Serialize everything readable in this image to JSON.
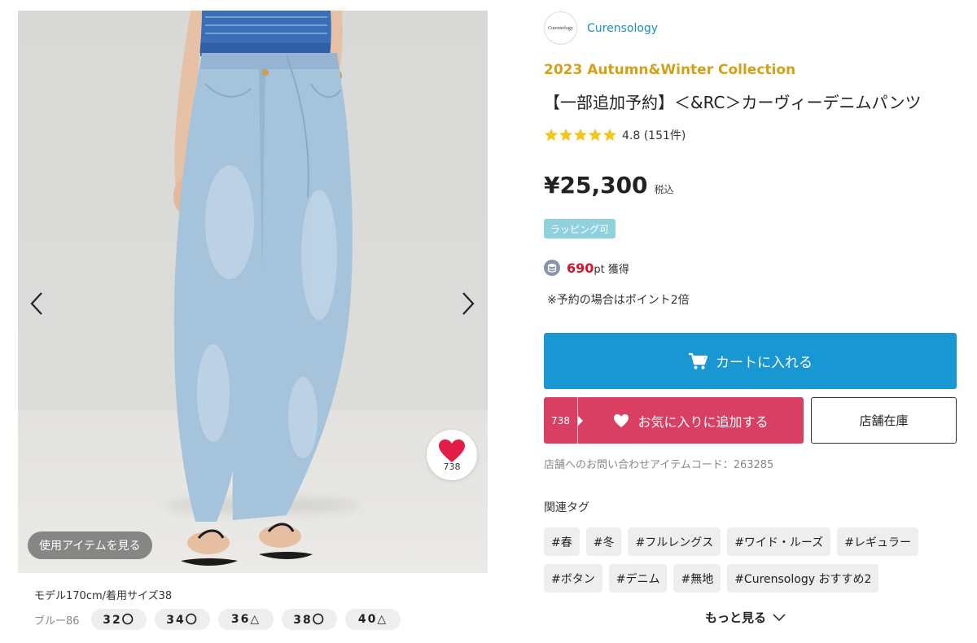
{
  "gallery": {
    "favorite_count": "738",
    "use_items_label": "使用アイテムを見る",
    "model_info": "モデル170cm/着用サイズ38",
    "color_label": "ブルー86",
    "sizes": [
      "32〇",
      "34〇",
      "36△",
      "38〇",
      "40△"
    ]
  },
  "product": {
    "brand_logo_text": "Curensology",
    "brand_name": "Curensology",
    "collection": "2023 Autumn&Winter Collection",
    "title": "【一部追加予約】＜&RC＞カーヴィーデニムパンツ",
    "rating_text": "4.8 (151件)",
    "rating": 4.8,
    "price": "¥25,300",
    "tax_label": "税込",
    "wrap_badge": "ラッピング可",
    "points_value": "690",
    "points_suffix": "pt 獲得",
    "reserve_note": "※予約の場合はポイント2倍"
  },
  "actions": {
    "cart_label": "カートに入れる",
    "favorite_count": "738",
    "favorite_label": "お気に入りに追加する",
    "store_stock_label": "店舗在庫",
    "item_code": "店舗へのお問い合わせアイテムコード：263285"
  },
  "tags": {
    "title": "関連タグ",
    "items": [
      "#春",
      "#冬",
      "#フルレングス",
      "#ワイド・ルーズ",
      "#レギュラー",
      "#ボタン",
      "#デニム",
      "#無地",
      "#Curensology おすすめ2"
    ],
    "more_label": "もっと見る"
  },
  "colors": {
    "brand_blue": "#1b8fc7",
    "cart_blue": "#1997d3",
    "favorite_pink": "#d83f63",
    "collection_gold": "#d4a017",
    "points_red": "#e0102a",
    "badge_teal": "#8fd1dd",
    "star_yellow": "#f5c518"
  }
}
